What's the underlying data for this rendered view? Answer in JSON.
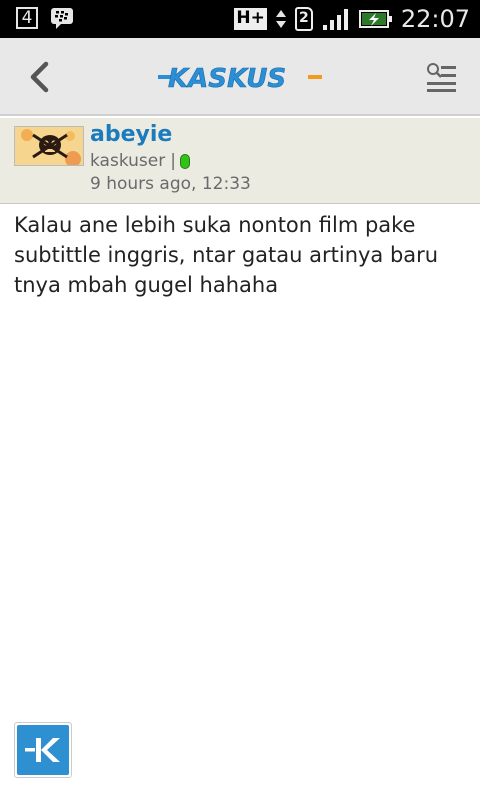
{
  "status_bar": {
    "notification_count": "4",
    "network_type": "H+",
    "sim_slot": "2",
    "time": "22:07",
    "icons": [
      "bbm-icon",
      "data-arrows-icon",
      "signal-icon",
      "battery-charging-icon"
    ]
  },
  "app_bar": {
    "logo_text": "KASKUS",
    "back_icon": "chevron-left-icon",
    "menu_icon": "search-menu-icon"
  },
  "post": {
    "username": "abeyie",
    "user_title": "kaskuser",
    "separator": "|",
    "online_status": "online",
    "timestamp": "9 hours ago, 12:33",
    "body": "Kalau ane lebih suka nonton film pake subtittle inggris, ntar gatau artinya baru tnya mbah gugel hahaha"
  },
  "fab": {
    "icon": "kaskus-k-icon"
  },
  "colors": {
    "username": "#1a7bbd",
    "logo_blue": "#2b8fd6",
    "logo_orange": "#f39a1e",
    "online": "#34c21a",
    "fab": "#2e8fd1"
  }
}
